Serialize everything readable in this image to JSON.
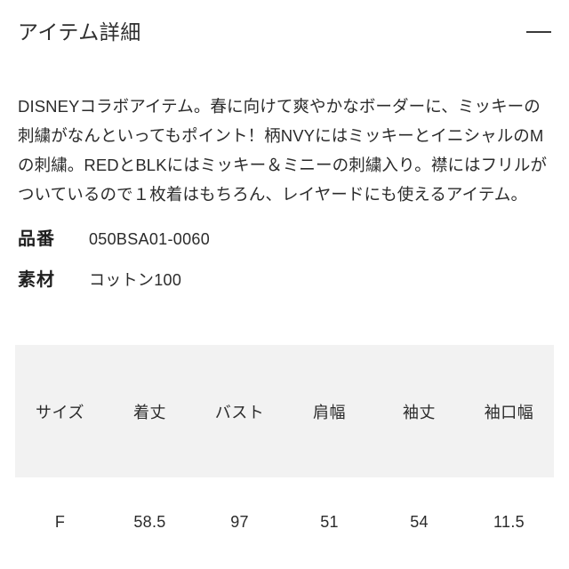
{
  "panel": {
    "title": "アイテム詳細",
    "toggle_icon": "minus-icon",
    "toggle_state": "expanded"
  },
  "description": "DISNEYコラボアイテム。春に向けて爽やかなボーダーに、ミッキーの刺繍がなんといってもポイント！柄NVYにはミッキーとイニシャルのMの刺繍。REDとBLKにはミッキー＆ミニーの刺繍入り。襟にはフリルがついているので１枚着はもちろん、レイヤードにも使えるアイテム。",
  "specs": [
    {
      "label": "品番",
      "value": "050BSA01-0060"
    },
    {
      "label": "素材",
      "value": "コットン100"
    }
  ],
  "size_table": {
    "headers": [
      "サイズ",
      "着丈",
      "バスト",
      "肩幅",
      "袖丈",
      "袖口幅"
    ],
    "rows": [
      [
        "F",
        "58.5",
        "97",
        "51",
        "54",
        "11.5"
      ]
    ]
  },
  "colors": {
    "background": "#ffffff",
    "text": "#2b2b2b",
    "heading": "#2e2e2e",
    "table_header_bg": "#f2f2f2",
    "divider": "#3a3a3a"
  }
}
